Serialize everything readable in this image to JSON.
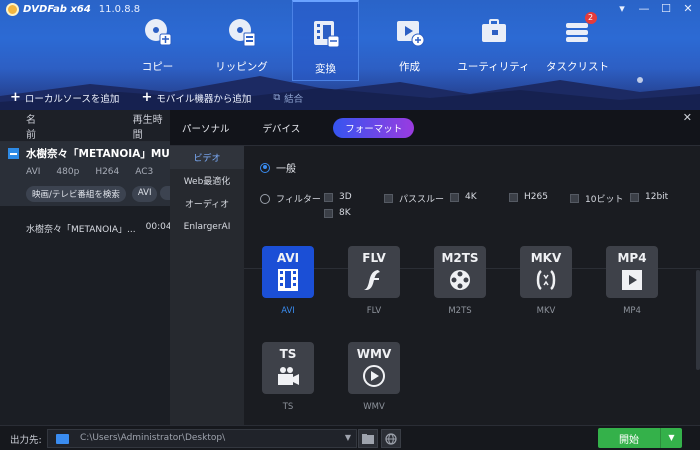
{
  "app": {
    "name": "DVDFab x64",
    "version": "11.0.8.8",
    "window_controls": [
      "▾",
      "—",
      "☐",
      "✕"
    ]
  },
  "nav": [
    {
      "label": "コピー",
      "icon": "disc-copy-icon",
      "active": false
    },
    {
      "label": "リッピング",
      "icon": "disc-rip-icon",
      "active": false
    },
    {
      "label": "変換",
      "icon": "film-convert-icon",
      "active": true
    },
    {
      "label": "作成",
      "icon": "video-create-icon",
      "active": false
    },
    {
      "label": "ユーティリティ",
      "icon": "toolbox-icon",
      "active": false
    },
    {
      "label": "タスクリスト",
      "icon": "task-list-icon",
      "active": false,
      "badge": "2"
    }
  ],
  "actions": {
    "add_local": "ローカルソースを追加",
    "add_mobile": "モバイル機器から追加",
    "merge": "結合"
  },
  "file_list": {
    "col_name": "名前",
    "col_playtime": "再生時間",
    "title": "水樹奈々「METANOIA」MUSIC",
    "meta": [
      "AVI",
      "480p",
      "H264",
      "AC3"
    ],
    "tags": [
      "映画/テレビ番組を検索",
      "AVI"
    ],
    "track_name": "水樹奈々「METANOIA」...",
    "track_time": "00:04"
  },
  "dialog": {
    "tabs": [
      "パーソナル",
      "デバイス",
      "フォーマット"
    ],
    "active_tab": "フォーマット",
    "menu": [
      "ビデオ",
      "Web最適化",
      "オーディオ",
      "EnlargerAI"
    ],
    "active_menu": "ビデオ",
    "general_label": "一般",
    "filter_label": "フィルター",
    "filters": [
      "3D",
      "パススルー",
      "4K",
      "H265",
      "10ビット",
      "12bit",
      "8K"
    ],
    "formats": [
      {
        "label": "AVI",
        "caption": "AVI",
        "icon": "film-strip-icon",
        "selected": true
      },
      {
        "label": "FLV",
        "caption": "FLV",
        "icon": "flash-icon",
        "selected": false
      },
      {
        "label": "M2TS",
        "caption": "M2TS",
        "icon": "film-reel-icon",
        "selected": false
      },
      {
        "label": "MKV",
        "caption": "MKV",
        "icon": "matroska-icon",
        "selected": false
      },
      {
        "label": "MP4",
        "caption": "MP4",
        "icon": "play-screen-icon",
        "selected": false
      },
      {
        "label": "TS",
        "caption": "TS",
        "icon": "video-camera-icon",
        "selected": false
      },
      {
        "label": "WMV",
        "caption": "WMV",
        "icon": "play-circle-icon",
        "selected": false
      }
    ]
  },
  "bottom": {
    "output_label": "出力先:",
    "output_path": "C:\\Users\\Administrator\\Desktop\\",
    "start_label": "開始",
    "start_dropdown": "▼"
  },
  "colors": {
    "accent_blue": "#3a8cf0",
    "start_green": "#34b14a",
    "format_pill_start": "#3555f0",
    "format_pill_end": "#9a3be0"
  }
}
